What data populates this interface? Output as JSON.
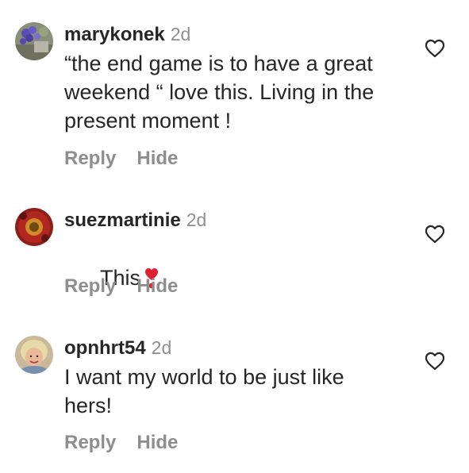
{
  "comments": [
    {
      "username": "marykonek",
      "time": "2d",
      "text": "“the end game is to have a great weekend “ love this. Living in the present moment !",
      "reply_label": "Reply",
      "hide_label": "Hide",
      "avatar": "flowers-avatar",
      "like_icon": "heart-outline-icon"
    },
    {
      "username": "suezmartinie",
      "time": "2d",
      "text": "This",
      "reply_label": "Reply",
      "hide_label": "Hide",
      "avatar": "flower-avatar",
      "like_icon": "heart-outline-icon",
      "emoji": "red-exclamation-heart-emoji"
    },
    {
      "username": "opnhrt54",
      "time": "2d",
      "text": "I want my world to be just like hers!",
      "reply_label": "Reply",
      "hide_label": "Hide",
      "avatar": "person-avatar",
      "like_icon": "heart-outline-icon"
    }
  ],
  "colors": {
    "text": "#262626",
    "secondary": "#8e8e8e",
    "emoji_red": "#e0202c"
  }
}
